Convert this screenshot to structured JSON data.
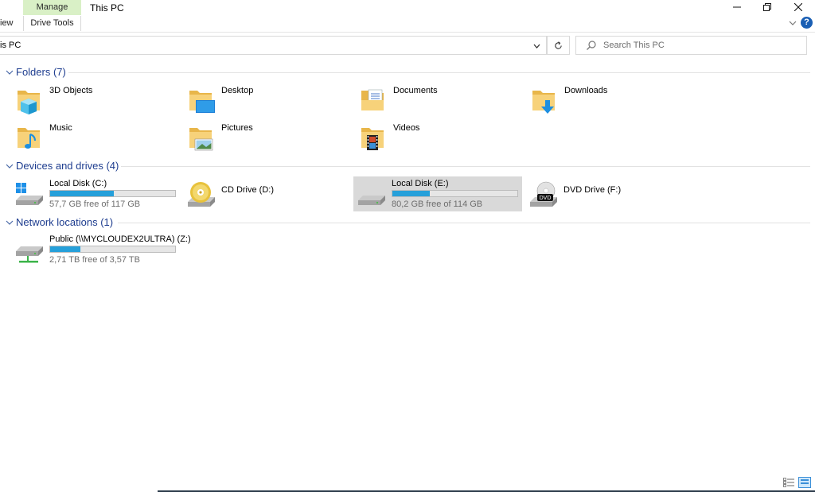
{
  "titlebar": {
    "context_header": "Manage",
    "tab_view": "iew",
    "tab_drive_tools": "Drive Tools",
    "window_title": "This PC",
    "help_label": "?"
  },
  "address": {
    "path": "is PC",
    "search_placeholder": "Search This PC"
  },
  "groups": {
    "folders": {
      "title": "Folders (7)",
      "items": [
        {
          "name": "3D Objects",
          "icon": "3d-objects-folder-icon"
        },
        {
          "name": "Desktop",
          "icon": "desktop-folder-icon"
        },
        {
          "name": "Documents",
          "icon": "documents-folder-icon"
        },
        {
          "name": "Downloads",
          "icon": "downloads-folder-icon"
        },
        {
          "name": "Music",
          "icon": "music-folder-icon"
        },
        {
          "name": "Pictures",
          "icon": "pictures-folder-icon"
        },
        {
          "name": "Videos",
          "icon": "videos-folder-icon"
        }
      ]
    },
    "drives": {
      "title": "Devices and drives (4)",
      "items": [
        {
          "name": "Local Disk (C:)",
          "free": "57,7 GB free of 117 GB",
          "used_fraction": 0.51,
          "icon": "windows-drive-icon"
        },
        {
          "name": "CD Drive (D:)",
          "icon": "cd-drive-icon"
        },
        {
          "name": "Local Disk (E:)",
          "free": "80,2 GB free of 114 GB",
          "used_fraction": 0.3,
          "icon": "hard-drive-icon",
          "selected": true
        },
        {
          "name": "DVD Drive (F:)",
          "icon": "dvd-drive-icon",
          "badge": "DVD"
        }
      ]
    },
    "network": {
      "title": "Network locations (1)",
      "items": [
        {
          "name": "Public (\\\\MYCLOUDEX2ULTRA) (Z:)",
          "free": "2,71 TB free of 3,57 TB",
          "used_fraction": 0.24,
          "icon": "network-drive-icon"
        }
      ]
    }
  },
  "colors": {
    "accent": "#26a0da",
    "group_title": "#1e3d8f",
    "selection": "#d9d9d9",
    "context_tab": "#d9f0c6"
  }
}
